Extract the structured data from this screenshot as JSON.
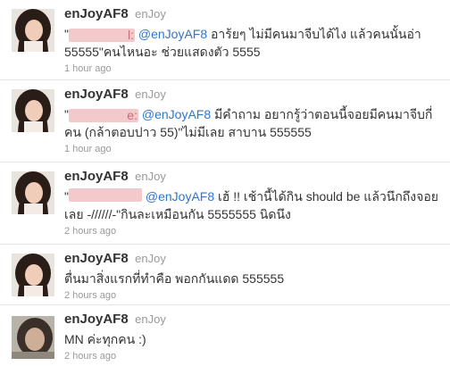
{
  "tweets": [
    {
      "screen_name": "enJoyAF8",
      "real_name": "enJoy",
      "open_quote": "\"",
      "redacted_name": "l:",
      "mention": "@enJoyAF8",
      "text": " อาร้ยๆ ไม่มีคนมาจีบได้ไง แล้วคนนั้นอ่า 55555\"คนไหนอะ ช่วยแสดงตัว 5555",
      "time": "1 hour ago"
    },
    {
      "screen_name": "enJoyAF8",
      "real_name": "enJoy",
      "open_quote": "\"",
      "redacted_name": "e:",
      "mention": "@enJoyAF8",
      "text": " มีคำถาม อยากรู้ว่าตอนนี้จอยมีคนมาจีบกี่คน (กล้าตอบปาว 55)\"ไม่มีเลย สาบาน 555555",
      "time": "1 hour ago"
    },
    {
      "screen_name": "enJoyAF8",
      "real_name": "enJoy",
      "open_quote": "\"",
      "redacted_name": "",
      "mention": "@enJoyAF8",
      "text": " เฮ้ !! เช้านี้ได้กิน should be แล้วนึกถึงจอยเลย -//////-\"กินละเหมือนกัน 5555555 นิดนึง",
      "time": "2 hours ago"
    },
    {
      "screen_name": "enJoyAF8",
      "real_name": "enJoy",
      "text": "ตื่นมาสิ่งแรกที่ทำคือ พอกกันแดด 555555",
      "time": "2 hours ago"
    },
    {
      "screen_name": "enJoyAF8",
      "real_name": "enJoy",
      "text": "MN ค่ะทุกคน :)",
      "time": "2 hours ago"
    }
  ]
}
